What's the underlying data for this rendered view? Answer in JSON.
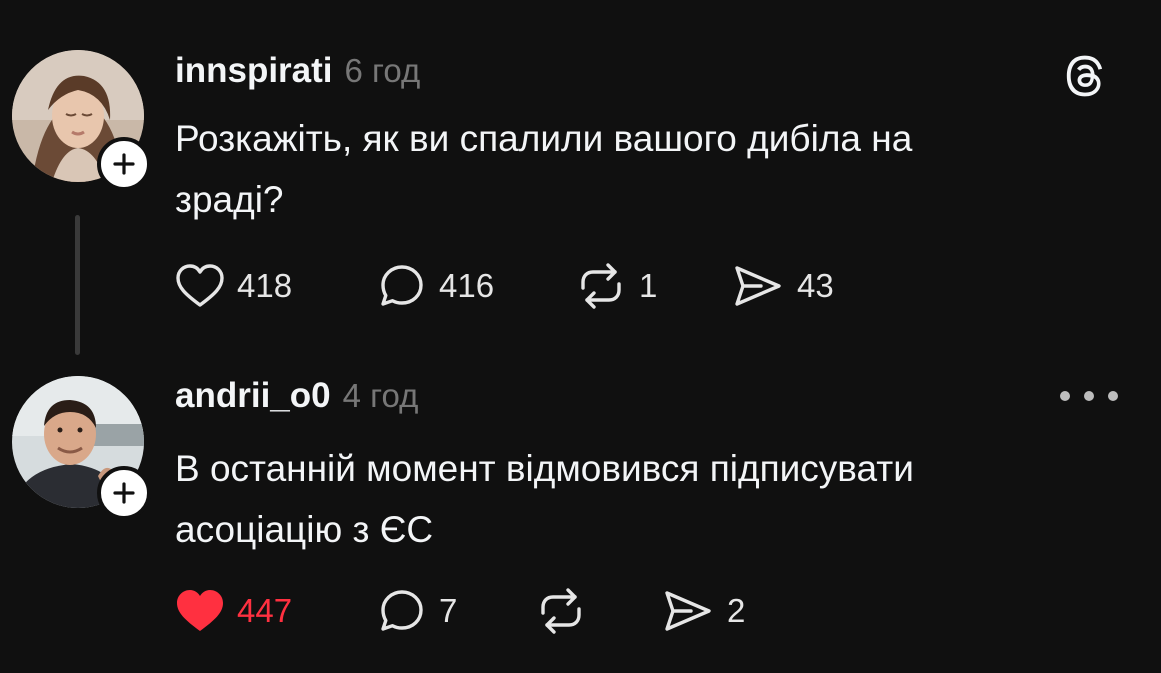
{
  "posts": [
    {
      "username": "innspirati",
      "time": "6 год",
      "text_lines": [
        "Розкажіть, як ви спалили вашого дибіла на",
        "зраді?"
      ],
      "likes": "418",
      "replies": "416",
      "reposts": "1",
      "shares": "43",
      "liked": false,
      "top_right_icon": "threads-logo-icon"
    },
    {
      "username": "andrii_o0",
      "time": "4 год",
      "text_lines": [
        "В останній момент відмовився підписувати",
        "асоціацію з ЄС"
      ],
      "likes": "447",
      "replies": "7",
      "reposts": "",
      "shares": "2",
      "liked": true,
      "top_right_icon": "more-options-icon"
    }
  ],
  "colors": {
    "background": "#101010",
    "text": "#f3f5f7",
    "muted": "#777777",
    "like_active": "#ff3040"
  }
}
